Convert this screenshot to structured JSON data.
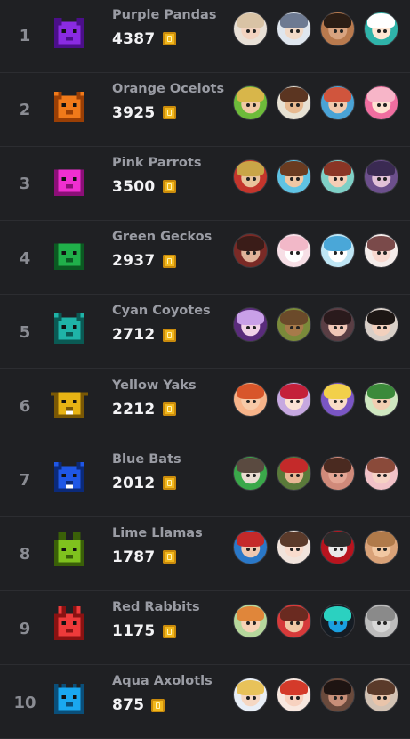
{
  "teams": [
    {
      "rank": "1",
      "name": "Purple Pandas",
      "score": "4387",
      "icon": "panda-icon",
      "color": "#8a2be2",
      "dark": "#4b0f8a",
      "avatars": [
        {
          "bg": "#e8e0d6",
          "hair": "#d9c3a5",
          "skin": "#f2d3c0"
        },
        {
          "bg": "#dfe6ee",
          "hair": "#6d7a92",
          "skin": "#f0d9c7"
        },
        {
          "bg": "#b97a4e",
          "hair": "#2b1d14",
          "skin": "#d8a37f"
        },
        {
          "bg": "#2fb3a9",
          "hair": "#ffffff",
          "skin": "#ffe7d4"
        }
      ]
    },
    {
      "rank": "2",
      "name": "Orange Ocelots",
      "score": "3925",
      "icon": "ocelot-icon",
      "color": "#f07a1a",
      "dark": "#9a3f05",
      "avatars": [
        {
          "bg": "#6dbb3a",
          "hair": "#d8b64a",
          "skin": "#f0c9a4"
        },
        {
          "bg": "#e8e2d4",
          "hair": "#5b3521",
          "skin": "#e7b990"
        },
        {
          "bg": "#4aa3d6",
          "hair": "#d0553d",
          "skin": "#f1c9ad"
        },
        {
          "bg": "#f06ea0",
          "hair": "#f7b5c8",
          "skin": "#ffe2d2"
        }
      ]
    },
    {
      "rank": "3",
      "name": "Pink Parrots",
      "score": "3500",
      "icon": "parrot-icon",
      "color": "#ef2fd0",
      "dark": "#8c0f78",
      "avatars": [
        {
          "bg": "#c4352c",
          "hair": "#c9a547",
          "skin": "#e8c39b"
        },
        {
          "bg": "#5fc3e4",
          "hair": "#6a3b20",
          "skin": "#f0c7a4"
        },
        {
          "bg": "#7fd0c6",
          "hair": "#8a3525",
          "skin": "#f6cdb5"
        },
        {
          "bg": "#6c4f8c",
          "hair": "#3a2a52",
          "skin": "#e2c1d8"
        }
      ]
    },
    {
      "rank": "4",
      "name": "Green Geckos",
      "score": "2937",
      "icon": "gecko-icon",
      "color": "#20b04a",
      "dark": "#0b5a22",
      "avatars": [
        {
          "bg": "#7a2a26",
          "hair": "#3a1c18",
          "skin": "#e0b39a"
        },
        {
          "bg": "#f7dfe6",
          "hair": "#f2b8c8",
          "skin": "#ffffff"
        },
        {
          "bg": "#bfe6f5",
          "hair": "#4aa7d8",
          "skin": "#ffffff"
        },
        {
          "bg": "#f4ecea",
          "hair": "#7a4a4a",
          "skin": "#f8d8cf"
        }
      ]
    },
    {
      "rank": "5",
      "name": "Cyan Coyotes",
      "score": "2712",
      "icon": "coyote-icon",
      "color": "#1fb3a7",
      "dark": "#0a5a54",
      "avatars": [
        {
          "bg": "#5a2c7c",
          "hair": "#c9a0e8",
          "skin": "#f1d2e8"
        },
        {
          "bg": "#7a8a3a",
          "hair": "#6b4a2a",
          "skin": "#a77a4a"
        },
        {
          "bg": "#5a3e44",
          "hair": "#2a1a1c",
          "skin": "#f0c6b6"
        },
        {
          "bg": "#d8cfc8",
          "hair": "#1c1614",
          "skin": "#f2d0bd"
        }
      ]
    },
    {
      "rank": "6",
      "name": "Yellow Yaks",
      "score": "2212",
      "icon": "yak-icon",
      "color": "#e7b314",
      "dark": "#7a5805",
      "avatars": [
        {
          "bg": "#f7b48a",
          "hair": "#d8562a",
          "skin": "#f7caa8"
        },
        {
          "bg": "#c6a8e0",
          "hair": "#c4203a",
          "skin": "#fbe3d4"
        },
        {
          "bg": "#7a56c4",
          "hair": "#f2d04a",
          "skin": "#f8dcc6"
        },
        {
          "bg": "#cfe7c0",
          "hair": "#3b8a3a",
          "skin": "#f1cfb2"
        }
      ]
    },
    {
      "rank": "7",
      "name": "Blue Bats",
      "score": "2012",
      "icon": "bat-icon",
      "color": "#1f57e6",
      "dark": "#0b2a7a",
      "avatars": [
        {
          "bg": "#3aa84a",
          "hair": "#5a4a40",
          "skin": "#e9ddd2"
        },
        {
          "bg": "#5a7a3a",
          "hair": "#c42a2a",
          "skin": "#e9b795"
        },
        {
          "bg": "#d08a7a",
          "hair": "#4a2a20",
          "skin": "#e4a694"
        },
        {
          "bg": "#f2c2c8",
          "hair": "#8a4a3a",
          "skin": "#f6d2c4"
        }
      ]
    },
    {
      "rank": "8",
      "name": "Lime Llamas",
      "score": "1787",
      "icon": "llama-icon",
      "color": "#7fc21e",
      "dark": "#3a6008",
      "avatars": [
        {
          "bg": "#2a78c8",
          "hair": "#c42a2a",
          "skin": "#f0c8b0"
        },
        {
          "bg": "#f1e4dc",
          "hair": "#5a3a2a",
          "skin": "#f9dccd"
        },
        {
          "bg": "#b8141e",
          "hair": "#2a2a2a",
          "skin": "#e8e8e8"
        },
        {
          "bg": "#d9a278",
          "hair": "#b07a4a",
          "skin": "#f2c8a2"
        }
      ]
    },
    {
      "rank": "9",
      "name": "Red Rabbits",
      "score": "1175",
      "icon": "rabbit-icon",
      "color": "#ee3a3a",
      "dark": "#8a1212",
      "avatars": [
        {
          "bg": "#b6d79c",
          "hair": "#e0863a",
          "skin": "#f7d3b5"
        },
        {
          "bg": "#d63a3a",
          "hair": "#6a2a20",
          "skin": "#f0c8a6"
        },
        {
          "bg": "#151c24",
          "hair": "#2bd1c0",
          "skin": "#1aa0e0"
        },
        {
          "bg": "#bcbcbc",
          "hair": "#8a8a8a",
          "skin": "#d7d7d7"
        }
      ]
    },
    {
      "rank": "10",
      "name": "Aqua Axolotls",
      "score": "875",
      "icon": "axolotl-icon",
      "color": "#1aa8f0",
      "dark": "#0a4f7a",
      "avatars": [
        {
          "bg": "#e8eef6",
          "hair": "#e8c25a",
          "skin": "#f5d7c2"
        },
        {
          "bg": "#f8e8e0",
          "hair": "#d43a2a",
          "skin": "#f7d2c0"
        },
        {
          "bg": "#6a4a3c",
          "hair": "#1e1412",
          "skin": "#c88f78"
        },
        {
          "bg": "#d2c2b4",
          "hair": "#5a3a2a",
          "skin": "#e9c4aa"
        }
      ]
    }
  ]
}
